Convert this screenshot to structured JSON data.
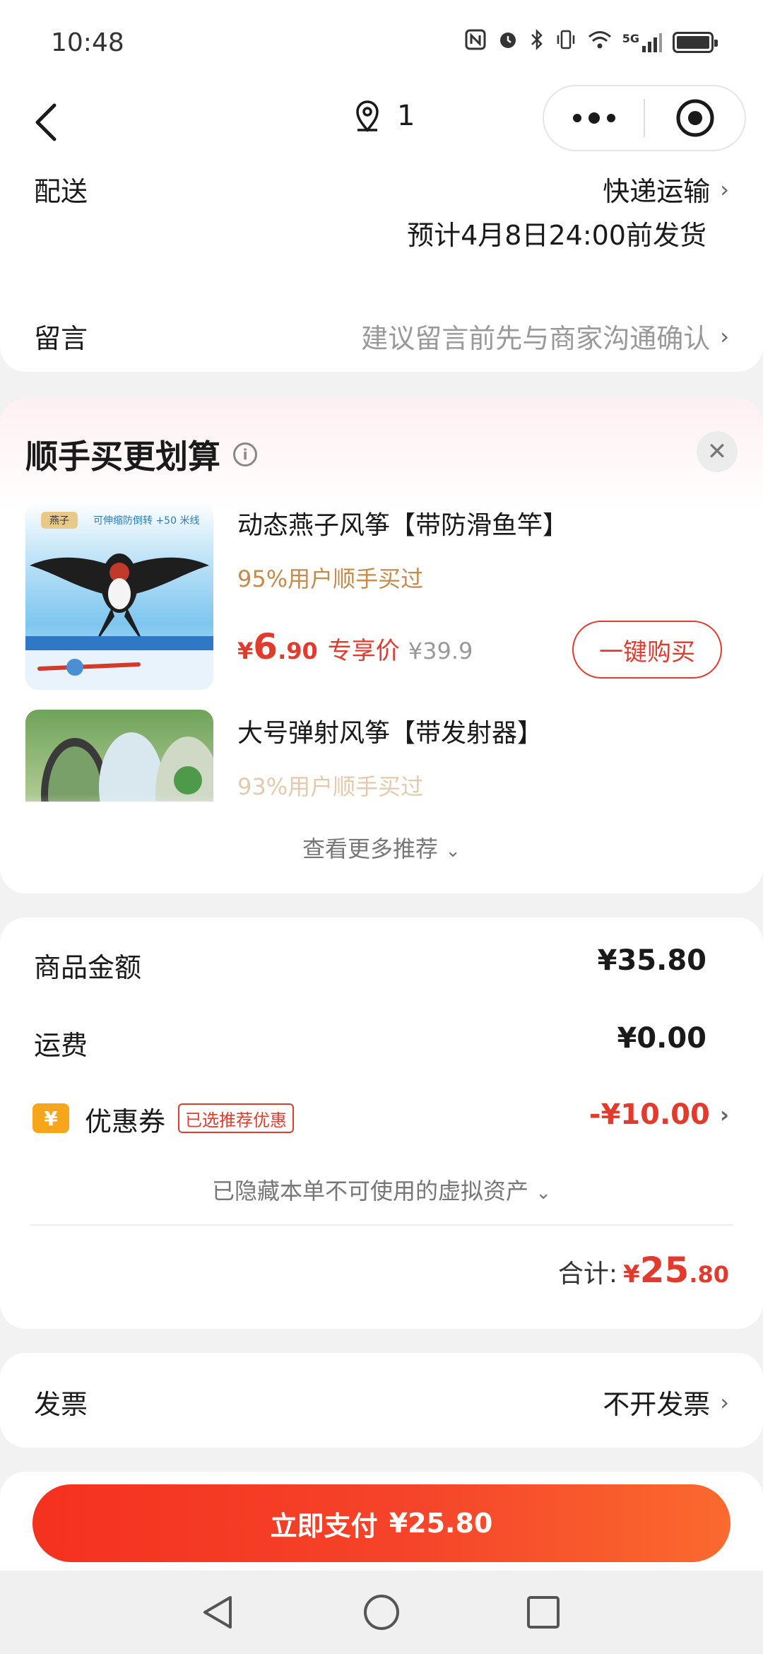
{
  "status_bar": {
    "time": "10:48",
    "network": "5G"
  },
  "nav": {
    "location_count": "1"
  },
  "delivery": {
    "label": "配送",
    "method": "快递运输",
    "estimate": "预计4月8日24:00前发货"
  },
  "message": {
    "label": "留言",
    "placeholder": "建议留言前先与商家沟通确认"
  },
  "recommend": {
    "title": "顺手买更划算",
    "products": [
      {
        "name": "动态燕子风筝【带防滑鱼竿】",
        "sold_text": "95%用户顺手买过",
        "price_yen": "¥",
        "price_int": "6",
        "price_dec": ".90",
        "price_tag": "专享价",
        "original_price": "¥39.9",
        "buy_label": "一键购买",
        "thumb_tag": "燕子",
        "thumb_caption": "可伸缩防倒转 +50 米线"
      },
      {
        "name": "大号弹射风筝【带发射器】",
        "sold_text": "93%用户顺手买过"
      }
    ],
    "more_label": "查看更多推荐"
  },
  "summary": {
    "goods_label": "商品金额",
    "goods_value": "¥35.80",
    "shipping_label": "运费",
    "shipping_value": "¥0.00",
    "coupon_label": "优惠券",
    "coupon_icon": "¥",
    "coupon_badge": "已选推荐优惠",
    "coupon_value": "-¥10.00",
    "hidden_note": "已隐藏本单不可使用的虚拟资产",
    "total_label": "合计:",
    "total_yen": "¥",
    "total_int": "25",
    "total_dec": ".80"
  },
  "invoice": {
    "label": "发票",
    "value": "不开发票"
  },
  "pay": {
    "label": "立即支付",
    "amount": "¥25.80"
  },
  "colors": {
    "accent": "#e23b2e",
    "sold_text": "#c68a4a",
    "coupon_icon": "#f7a61b"
  }
}
